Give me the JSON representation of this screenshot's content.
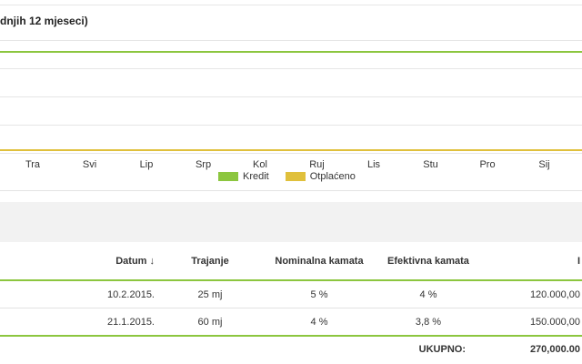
{
  "chart": {
    "title_visible": "dnjih 12 mjeseci)",
    "months": [
      "Tra",
      "Svi",
      "Lip",
      "Srp",
      "Kol",
      "Ruj",
      "Lis",
      "Stu",
      "Pro",
      "Sij"
    ],
    "legend": [
      {
        "label": "Kredit",
        "color": "#8cc63f"
      },
      {
        "label": "Otplaćeno",
        "color": "#e0c03c"
      }
    ],
    "grid": true
  },
  "chart_data": {
    "type": "line",
    "title": "",
    "xlabel": "",
    "ylabel": "",
    "categories": [
      "Tra",
      "Svi",
      "Lip",
      "Srp",
      "Kol",
      "Ruj",
      "Lis",
      "Stu",
      "Pro",
      "Sij"
    ],
    "series": [
      {
        "name": "Kredit",
        "color": "#8cc63f"
      },
      {
        "name": "Otplaćeno",
        "color": "#e0c03c"
      }
    ]
  },
  "table": {
    "headers": {
      "datum": "Datum ↓",
      "trajanje": "Trajanje",
      "nominalna": "Nominalna kamata",
      "efektivna": "Efektivna kamata",
      "iznos": "I"
    },
    "rows": [
      {
        "datum": "10.2.2015.",
        "trajanje": "25 mj",
        "nominalna": "5 %",
        "efektivna": "4 %",
        "iznos": "120.000,00"
      },
      {
        "datum": "21.1.2015.",
        "trajanje": "60 mj",
        "nominalna": "4 %",
        "efektivna": "3,8 %",
        "iznos": "150.000,00"
      }
    ],
    "total_label": "UKUPNO:",
    "total_value": "270,000.00"
  }
}
